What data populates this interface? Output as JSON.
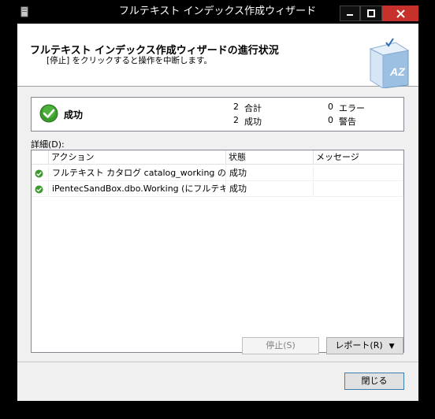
{
  "window": {
    "title": "フルテキスト インデックス作成ウィザード",
    "controls": [
      "minimize-icon",
      "maximize-icon",
      "close-icon"
    ]
  },
  "header": {
    "title": "フルテキスト インデックス作成ウィザードの進行状況",
    "subtitle": "[停止] をクリックすると操作を中断します。",
    "icon": "book-az-icon",
    "art_text": "AZ"
  },
  "summary": {
    "status": "成功",
    "status_icon": "success-check-icon",
    "total_count": "2",
    "total_label": "合計",
    "success_count": "2",
    "success_label": "成功",
    "error_count": "0",
    "error_label": "エラー",
    "warning_count": "0",
    "warning_label": "警告"
  },
  "details": {
    "label": "詳細(D):",
    "columns": [
      "アクション",
      "状態",
      "メッセージ"
    ],
    "rows": [
      {
        "icon": "success-check-icon",
        "action": "フルテキスト カタログ catalog_working の作...",
        "status": "成功",
        "message": ""
      },
      {
        "icon": "success-check-icon",
        "action": "iPentecSandBox.dbo.Working (にフルテキス...",
        "status": "成功",
        "message": ""
      }
    ]
  },
  "buttons": {
    "stop": "停止(S)",
    "report": "レポート(R)",
    "close": "閉じる"
  },
  "colors": {
    "accent_check": "#3a9a2c",
    "close_button": "#c7312b",
    "focus_border": "#3c7fb1"
  }
}
